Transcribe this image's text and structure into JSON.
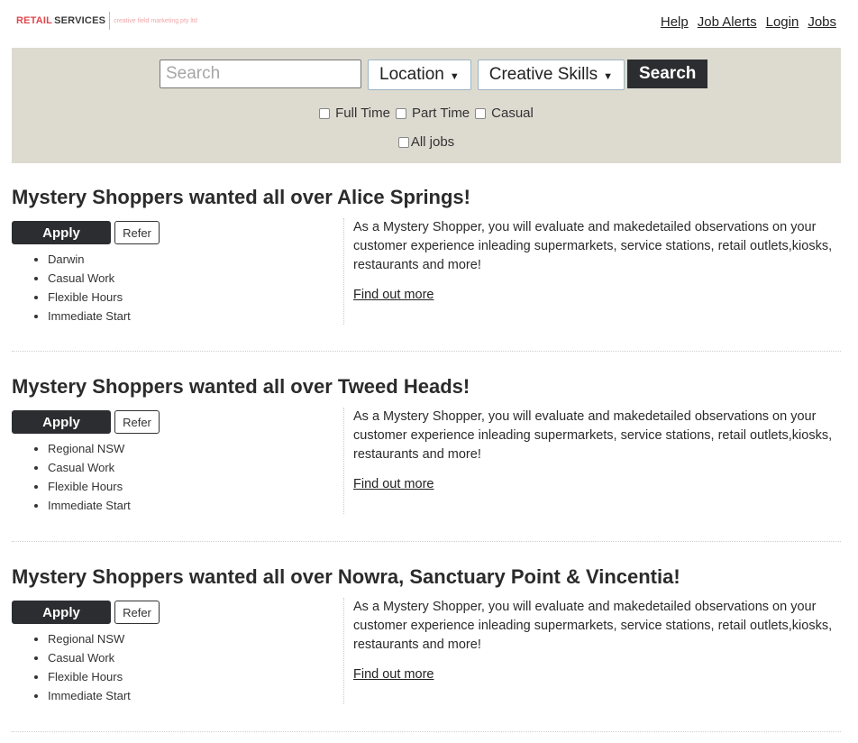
{
  "brand": {
    "name_red": "RETAIL",
    "name_dark": "SERVICES",
    "tagline": "creative field marketing pty ltd"
  },
  "nav": {
    "items": [
      "Help",
      "Job Alerts",
      "Login",
      "Jobs"
    ]
  },
  "search": {
    "placeholder": "Search",
    "location_label": "Location",
    "category_label": "Creative Skills",
    "button_label": "Search",
    "filters": [
      "Full Time",
      "Part Time",
      "Casual"
    ],
    "all_jobs_label": "All jobs"
  },
  "listings": [
    {
      "title": "Mystery Shoppers wanted all over Alice Springs!",
      "apply_label": "Apply",
      "refer_label": "Refer",
      "tags": [
        "Darwin",
        "Casual Work",
        "Flexible Hours",
        "Immediate Start"
      ],
      "description": "As a Mystery Shopper, you will evaluate and makedetailed observations on your customer experience inleading supermarkets, service stations, retail outlets,kiosks, restaurants and more!",
      "link_label": "Find out more"
    },
    {
      "title": "Mystery Shoppers wanted all over Tweed Heads!",
      "apply_label": "Apply",
      "refer_label": "Refer",
      "tags": [
        "Regional NSW",
        "Casual Work",
        "Flexible Hours",
        "Immediate Start"
      ],
      "description": "As a Mystery Shopper, you will evaluate and makedetailed observations on your customer experience inleading supermarkets, service stations, retail outlets,kiosks, restaurants and more!",
      "link_label": "Find out more"
    },
    {
      "title": "Mystery Shoppers wanted all over Nowra, Sanctuary Point & Vincentia!",
      "apply_label": "Apply",
      "refer_label": "Refer",
      "tags": [
        "Regional NSW",
        "Casual Work",
        "Flexible Hours",
        "Immediate Start"
      ],
      "description": "As a Mystery Shopper, you will evaluate and makedetailed observations on your customer experience inleading supermarkets, service stations, retail outlets,kiosks, restaurants and more!",
      "link_label": "Find out more"
    }
  ]
}
